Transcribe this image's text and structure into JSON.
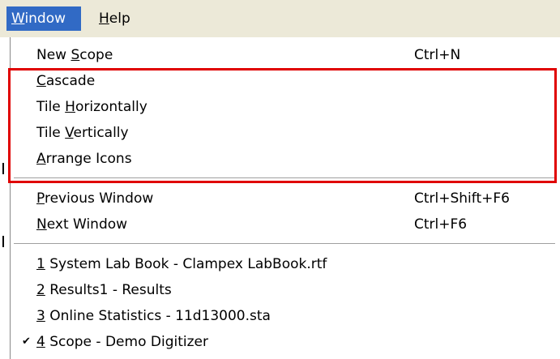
{
  "menubar": {
    "window_label": "Window",
    "help_label": "Help"
  },
  "menu": {
    "new_scope": {
      "label": "New Scope",
      "shortcut": "Ctrl+N"
    },
    "cascade": {
      "label": "Cascade"
    },
    "tile_horizontally": {
      "label": "Tile Horizontally"
    },
    "tile_vertically": {
      "label": "Tile Vertically"
    },
    "arrange_icons": {
      "label": "Arrange Icons"
    },
    "previous_window": {
      "label": "Previous Window",
      "shortcut": "Ctrl+Shift+F6"
    },
    "next_window": {
      "label": "Next Window",
      "shortcut": "Ctrl+F6"
    },
    "windows": [
      {
        "num": "1",
        "title": " System Lab Book - Clampex LabBook.rtf",
        "checked": false
      },
      {
        "num": "2",
        "title": " Results1 - Results",
        "checked": false
      },
      {
        "num": "3",
        "title": " Online Statistics - 11d13000.sta",
        "checked": false
      },
      {
        "num": "4",
        "title": " Scope - Demo Digitizer",
        "checked": true
      }
    ],
    "check_glyph": "✔"
  },
  "annotation": {
    "highlight_color": "#e00000"
  },
  "colors": {
    "menu_highlight": "#316ac5"
  }
}
